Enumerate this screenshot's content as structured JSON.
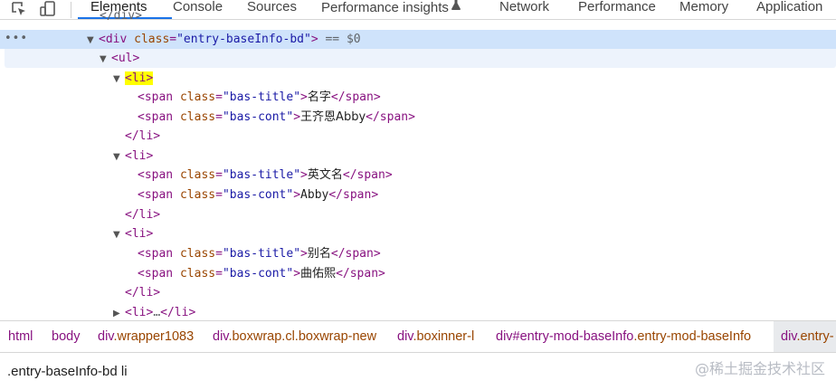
{
  "toolbar": {
    "tabs": [
      "Elements",
      "Console",
      "Sources",
      "Performance insights",
      "Network",
      "Performance",
      "Memory",
      "Application"
    ],
    "flask_icon": "flask-icon",
    "inspect_icon": "inspect-element-icon",
    "device_icon": "device-toggle-icon"
  },
  "dom": {
    "selected_eq": " == $0",
    "lines": [
      {
        "tag_open": "<div",
        "attr": "class",
        "val": "\"entry-baseInfo-bd\"",
        "tag_close": ">"
      },
      {
        "tag": "<ul>"
      },
      {
        "tag": "<li>"
      },
      {
        "tag_open": "<span",
        "attr": "class",
        "val": "\"bas-title\"",
        "text": "名字",
        "tag_end": "</span>"
      },
      {
        "tag_open": "<span",
        "attr": "class",
        "val": "\"bas-cont\"",
        "text": "王齐恩Abby",
        "tag_end": "</span>"
      },
      {
        "tag": "</li>"
      },
      {
        "tag": "<li>"
      },
      {
        "tag_open": "<span",
        "attr": "class",
        "val": "\"bas-title\"",
        "text": "英文名",
        "tag_end": "</span>"
      },
      {
        "tag_open": "<span",
        "attr": "class",
        "val": "\"bas-cont\"",
        "text": "Abby",
        "tag_end": "</span>"
      },
      {
        "tag": "</li>"
      },
      {
        "tag": "<li>"
      },
      {
        "tag_open": "<span",
        "attr": "class",
        "val": "\"bas-title\"",
        "text": "别名",
        "tag_end": "</span>"
      },
      {
        "tag_open": "<span",
        "attr": "class",
        "val": "\"bas-cont\"",
        "text": "曲佑熙",
        "tag_end": "</span>"
      },
      {
        "tag": "</li>"
      },
      {
        "tag": "<li>",
        "ellipsis": "…",
        "tag_end": "</li>"
      }
    ]
  },
  "breadcrumbs": {
    "html": "html",
    "body": "body",
    "c3_tag": "div",
    "c3_cls": ".wrapper1083",
    "c4_tag": "div",
    "c4_cls": ".boxwrap.cl.boxwrap-new",
    "c5_tag": "div",
    "c5_cls": ".boxinner-l",
    "c6_tag": "div",
    "c6_id": "#entry-mod-baseInfo",
    "c6_cls": ".entry-mod-baseInfo",
    "c7_tag": "div",
    "c7_cls": ".entry-"
  },
  "search": {
    "value": ".entry-baseInfo-bd li"
  },
  "watermark": "@稀土掘金技术社区"
}
